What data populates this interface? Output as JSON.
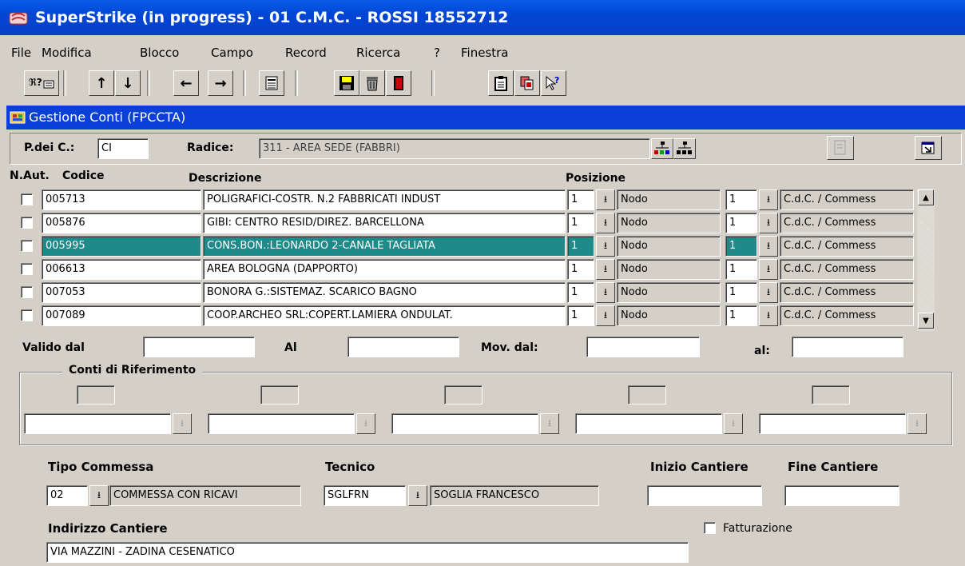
{
  "window": {
    "title": "SuperStrike (in progress) - 01 C.M.C. - ROSSI 18552712"
  },
  "menu": [
    "File",
    "Modifica",
    "Blocco",
    "Campo",
    "Record",
    "Ricerca",
    "?",
    "Finestra"
  ],
  "form": {
    "title": "Gestione Conti (FPCCTA)",
    "piano_label": "P.dei C.:",
    "piano_value": "CI",
    "radice_label": "Radice:",
    "radice_value": "311 - AREA SEDE (FABBRI)"
  },
  "table": {
    "headers": {
      "naut": "N.Aut.",
      "codice": "Codice",
      "descrizione": "Descrizione",
      "posizione": "Posizione"
    },
    "rows": [
      {
        "codice": "005713",
        "descrizione": "POLIGRAFICI-COSTR. N.2 FABBRICATI INDUST",
        "pos1": "1",
        "tipo": "Nodo",
        "pos2": "1",
        "categoria": "C.d.C. / Commess"
      },
      {
        "codice": "005876",
        "descrizione": "GIBI: CENTRO RESID/DIREZ. BARCELLONA",
        "pos1": "1",
        "tipo": "Nodo",
        "pos2": "1",
        "categoria": "C.d.C. / Commess"
      },
      {
        "codice": "005995",
        "descrizione": "CONS.BON.:LEONARDO 2-CANALE TAGLIATA",
        "pos1": "1",
        "tipo": "Nodo",
        "pos2": "1",
        "categoria": "C.d.C. / Commess"
      },
      {
        "codice": "006613",
        "descrizione": "AREA BOLOGNA (DAPPORTO)",
        "pos1": "1",
        "tipo": "Nodo",
        "pos2": "1",
        "categoria": "C.d.C. / Commess"
      },
      {
        "codice": "007053",
        "descrizione": "BONORA G.:SISTEMAZ. SCARICO BAGNO",
        "pos1": "1",
        "tipo": "Nodo",
        "pos2": "1",
        "categoria": "C.d.C. / Commess"
      },
      {
        "codice": "007089",
        "descrizione": "COOP.ARCHEO SRL:COPERT.LAMIERA ONDULAT.",
        "pos1": "1",
        "tipo": "Nodo",
        "pos2": "1",
        "categoria": "C.d.C. / Commess"
      }
    ]
  },
  "validity": {
    "valido_dal_label": "Valido dal",
    "al_label": "Al",
    "mov_dal_label": "Mov. dal:",
    "mov_al_label": "al:"
  },
  "riferimento": {
    "title": "Conti di Riferimento"
  },
  "commessa": {
    "tipo_label": "Tipo Commessa",
    "tipo_code": "02",
    "tipo_desc": "COMMESSA CON RICAVI",
    "tecnico_label": "Tecnico",
    "tecnico_code": "SGLFRN",
    "tecnico_desc": "SOGLIA FRANCESCO",
    "inizio_label": "Inizio Cantiere",
    "fine_label": "Fine Cantiere",
    "indirizzo_label": "Indirizzo Cantiere",
    "indirizzo_value": "VIA MAZZINI - ZADINA CESENATICO",
    "fatturazione_label": "Fatturazione"
  }
}
